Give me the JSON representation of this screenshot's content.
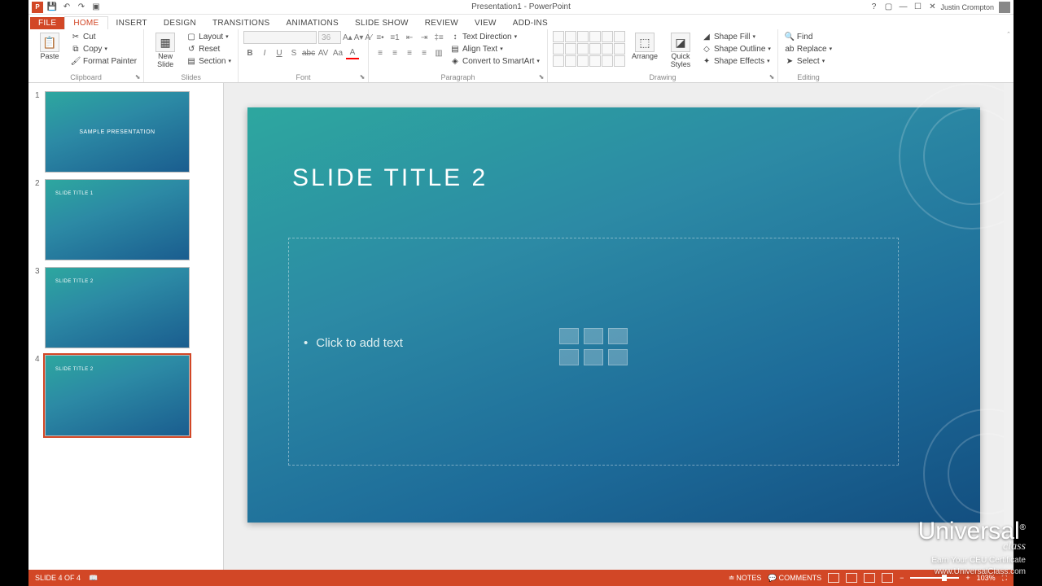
{
  "window": {
    "title": "Presentation1 - PowerPoint",
    "user": "Justin Crompton"
  },
  "tabs": {
    "file": "FILE",
    "home": "HOME",
    "insert": "INSERT",
    "design": "DESIGN",
    "transitions": "TRANSITIONS",
    "animations": "ANIMATIONS",
    "slideshow": "SLIDE SHOW",
    "review": "REVIEW",
    "view": "VIEW",
    "addins": "ADD-INS"
  },
  "ribbon": {
    "clipboard": {
      "label": "Clipboard",
      "paste": "Paste",
      "cut": "Cut",
      "copy": "Copy",
      "format_painter": "Format Painter"
    },
    "slides": {
      "label": "Slides",
      "new_slide": "New\nSlide",
      "layout": "Layout",
      "reset": "Reset",
      "section": "Section"
    },
    "font": {
      "label": "Font",
      "size": "36"
    },
    "paragraph": {
      "label": "Paragraph",
      "text_direction": "Text Direction",
      "align_text": "Align Text",
      "convert_smartart": "Convert to SmartArt"
    },
    "drawing": {
      "label": "Drawing",
      "arrange": "Arrange",
      "quick_styles": "Quick\nStyles",
      "shape_fill": "Shape Fill",
      "shape_outline": "Shape Outline",
      "shape_effects": "Shape Effects"
    },
    "editing": {
      "label": "Editing",
      "find": "Find",
      "replace": "Replace",
      "select": "Select"
    }
  },
  "thumbnails": [
    {
      "num": "1",
      "title_main": "SAMPLE PRESENTATION"
    },
    {
      "num": "2",
      "title_small": "SLIDE TITLE 1"
    },
    {
      "num": "3",
      "title_small": "SLIDE TITLE 2"
    },
    {
      "num": "4",
      "title_small": "SLIDE TITLE 2",
      "selected": true
    }
  ],
  "slide": {
    "title": "SLIDE TITLE 2",
    "placeholder": "Click to add text"
  },
  "status": {
    "slide_of": "SLIDE 4 OF 4",
    "notes": "NOTES",
    "comments": "COMMENTS",
    "zoom": "103%"
  },
  "watermark": {
    "logo": "Universal",
    "sub": "class",
    "line1": "Earn Your CEU Certificate",
    "line2": "www.UniversalClass.com"
  }
}
